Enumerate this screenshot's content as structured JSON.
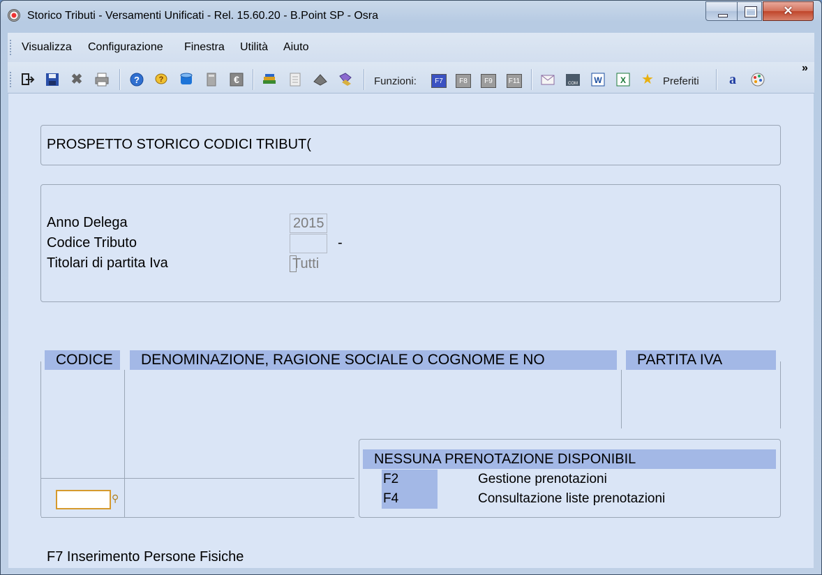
{
  "window": {
    "title": "Storico Tributi - Versamenti Unificati - Rel. 15.60.20 - B.Point SP - Osra"
  },
  "menu": {
    "items": [
      "Visualizza",
      "Configurazione",
      "Finestra",
      "Utilità",
      "Aiuto"
    ]
  },
  "toolbar": {
    "funzioni_label": "Funzioni:",
    "fkeys": [
      "F7",
      "F8",
      "F9",
      "F11"
    ],
    "preferiti_label": "Preferiti",
    "overflow": "»",
    "icons": [
      "exit-icon",
      "save-icon",
      "delete-icon",
      "print-icon",
      "help-icon",
      "tips-icon",
      "database-icon",
      "calculator-icon",
      "euro-icon",
      "books-icon",
      "document-icon",
      "book-icon",
      "archive-icon",
      "mail-icon",
      "com-icon",
      "word-icon",
      "excel-icon",
      "star-icon",
      "font-icon",
      "palette-icon"
    ]
  },
  "header": {
    "title": "PROSPETTO STORICO CODICI TRIBUT("
  },
  "filters": {
    "anno_label": "Anno Delega",
    "anno_value": "2015",
    "codice_label": "Codice Tributo",
    "codice_value": "",
    "codice_suffix": "-",
    "titolari_label": "Titolari di partita Iva",
    "titolari_value": "Tutti"
  },
  "table": {
    "columns": [
      "CODICE",
      "DENOMINAZIONE, RAGIONE SOCIALE O COGNOME E NO",
      "PARTITA IVA"
    ],
    "rows": [],
    "input_value": ""
  },
  "prenotazioni": {
    "title": "NESSUNA PRENOTAZIONE DISPONIBIL",
    "keys": [
      {
        "key": "F2",
        "label": "Gestione prenotazioni"
      },
      {
        "key": "F4",
        "label": "Consultazione liste prenotazioni"
      }
    ]
  },
  "footer": {
    "hint": "F7 Inserimento Persone Fisiche"
  },
  "colors": {
    "accent": "#a3b8e6",
    "background": "#dae5f6",
    "input_border": "#d69a2d"
  }
}
